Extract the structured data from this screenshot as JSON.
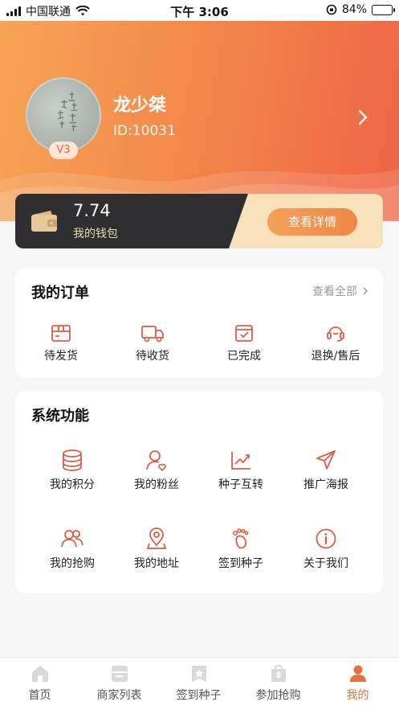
{
  "status_bar": {
    "carrier": "中国联通",
    "time": "下午 3:06",
    "battery": "84%",
    "battery_level": 0.84
  },
  "profile": {
    "name": "龙少桀",
    "id_text": "ID:10031",
    "level": "V3"
  },
  "wallet": {
    "amount": "7.74",
    "label": "我的钱包",
    "detail_button": "查看详情"
  },
  "orders": {
    "title": "我的订单",
    "view_all": "查看全部",
    "items": [
      {
        "label": "待发货",
        "icon": "box-icon"
      },
      {
        "label": "待收货",
        "icon": "truck-icon"
      },
      {
        "label": "已完成",
        "icon": "checklist-icon"
      },
      {
        "label": "退换/售后",
        "icon": "headset-icon"
      }
    ]
  },
  "functions": {
    "title": "系统功能",
    "items": [
      {
        "label": "我的积分",
        "icon": "coins-icon"
      },
      {
        "label": "我的粉丝",
        "icon": "fan-icon"
      },
      {
        "label": "种子互转",
        "icon": "trend-icon"
      },
      {
        "label": "推广海报",
        "icon": "paper-plane-icon"
      },
      {
        "label": "我的抢购",
        "icon": "group-icon"
      },
      {
        "label": "我的地址",
        "icon": "location-icon"
      },
      {
        "label": "签到种子",
        "icon": "footprint-icon"
      },
      {
        "label": "关于我们",
        "icon": "info-icon"
      }
    ]
  },
  "tabs": [
    {
      "label": "首页",
      "icon": "home-icon",
      "active": false
    },
    {
      "label": "商家列表",
      "icon": "store-icon",
      "active": false
    },
    {
      "label": "签到种子",
      "icon": "badge-icon",
      "active": false
    },
    {
      "label": "参加抢购",
      "icon": "bag-icon",
      "active": false
    },
    {
      "label": "我的",
      "icon": "user-icon",
      "active": true
    }
  ],
  "colors": {
    "accent": "#e8703c",
    "icon_red": "#e25b45",
    "header_start": "#f6a456",
    "header_end": "#ee6446",
    "wallet_dark": "#2f2f31",
    "wallet_gold": "#f7e2bb"
  }
}
